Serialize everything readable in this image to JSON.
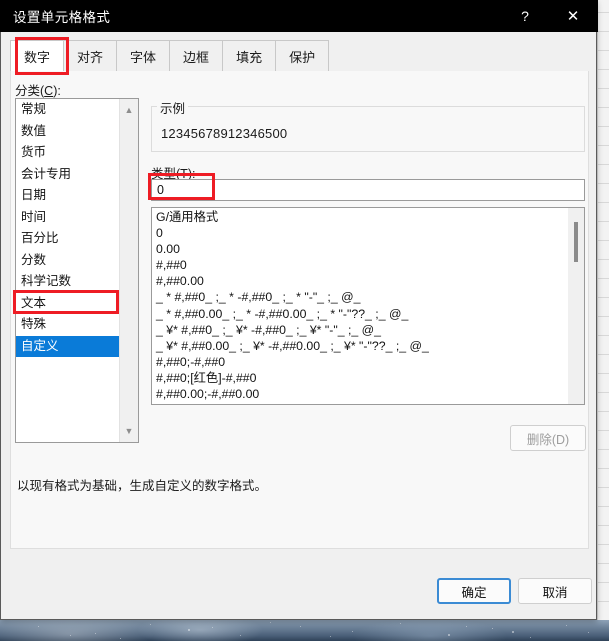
{
  "window": {
    "title": "设置单元格格式",
    "help_icon": "?",
    "close_icon": "✕"
  },
  "tabs": [
    {
      "label": "数字",
      "active": true
    },
    {
      "label": "对齐",
      "active": false
    },
    {
      "label": "字体",
      "active": false
    },
    {
      "label": "边框",
      "active": false
    },
    {
      "label": "填充",
      "active": false
    },
    {
      "label": "保护",
      "active": false
    }
  ],
  "category": {
    "label_prefix": "分类(",
    "label_key": "C",
    "label_suffix": "):",
    "items": [
      {
        "label": "常规",
        "selected": false
      },
      {
        "label": "数值",
        "selected": false
      },
      {
        "label": "货币",
        "selected": false
      },
      {
        "label": "会计专用",
        "selected": false
      },
      {
        "label": "日期",
        "selected": false
      },
      {
        "label": "时间",
        "selected": false
      },
      {
        "label": "百分比",
        "selected": false
      },
      {
        "label": "分数",
        "selected": false
      },
      {
        "label": "科学记数",
        "selected": false
      },
      {
        "label": "文本",
        "selected": false
      },
      {
        "label": "特殊",
        "selected": false
      },
      {
        "label": "自定义",
        "selected": true
      }
    ],
    "scroll_up_icon": "▲",
    "scroll_down_icon": "▼"
  },
  "sample": {
    "legend": "示例",
    "value": "12345678912346500"
  },
  "type": {
    "label_prefix": "类型(",
    "label_key": "T",
    "label_suffix": "):",
    "value": "0",
    "placeholder": ""
  },
  "format_list": {
    "items": [
      "G/通用格式",
      "0",
      "0.00",
      "#,##0",
      "#,##0.00",
      "_ * #,##0_ ;_ * -#,##0_ ;_ * \"-\"_ ;_ @_ ",
      "_ * #,##0.00_ ;_ * -#,##0.00_ ;_ * \"-\"??_ ;_ @_ ",
      "_ ¥* #,##0_ ;_ ¥* -#,##0_ ;_ ¥* \"-\"_ ;_ @_ ",
      "_ ¥* #,##0.00_ ;_ ¥* -#,##0.00_ ;_ ¥* \"-\"??_ ;_ @_ ",
      "#,##0;-#,##0",
      "#,##0;[红色]-#,##0",
      "#,##0.00;-#,##0.00"
    ]
  },
  "buttons": {
    "delete": "删除(D)",
    "ok": "确定",
    "cancel": "取消"
  },
  "description": "以现有格式为基础，生成自定义的数字格式。",
  "colors": {
    "titlebar": "#000000",
    "selection": "#0a7bd8",
    "annotation_red": "#ee1c24",
    "focus_blue": "#3b8bd4"
  }
}
